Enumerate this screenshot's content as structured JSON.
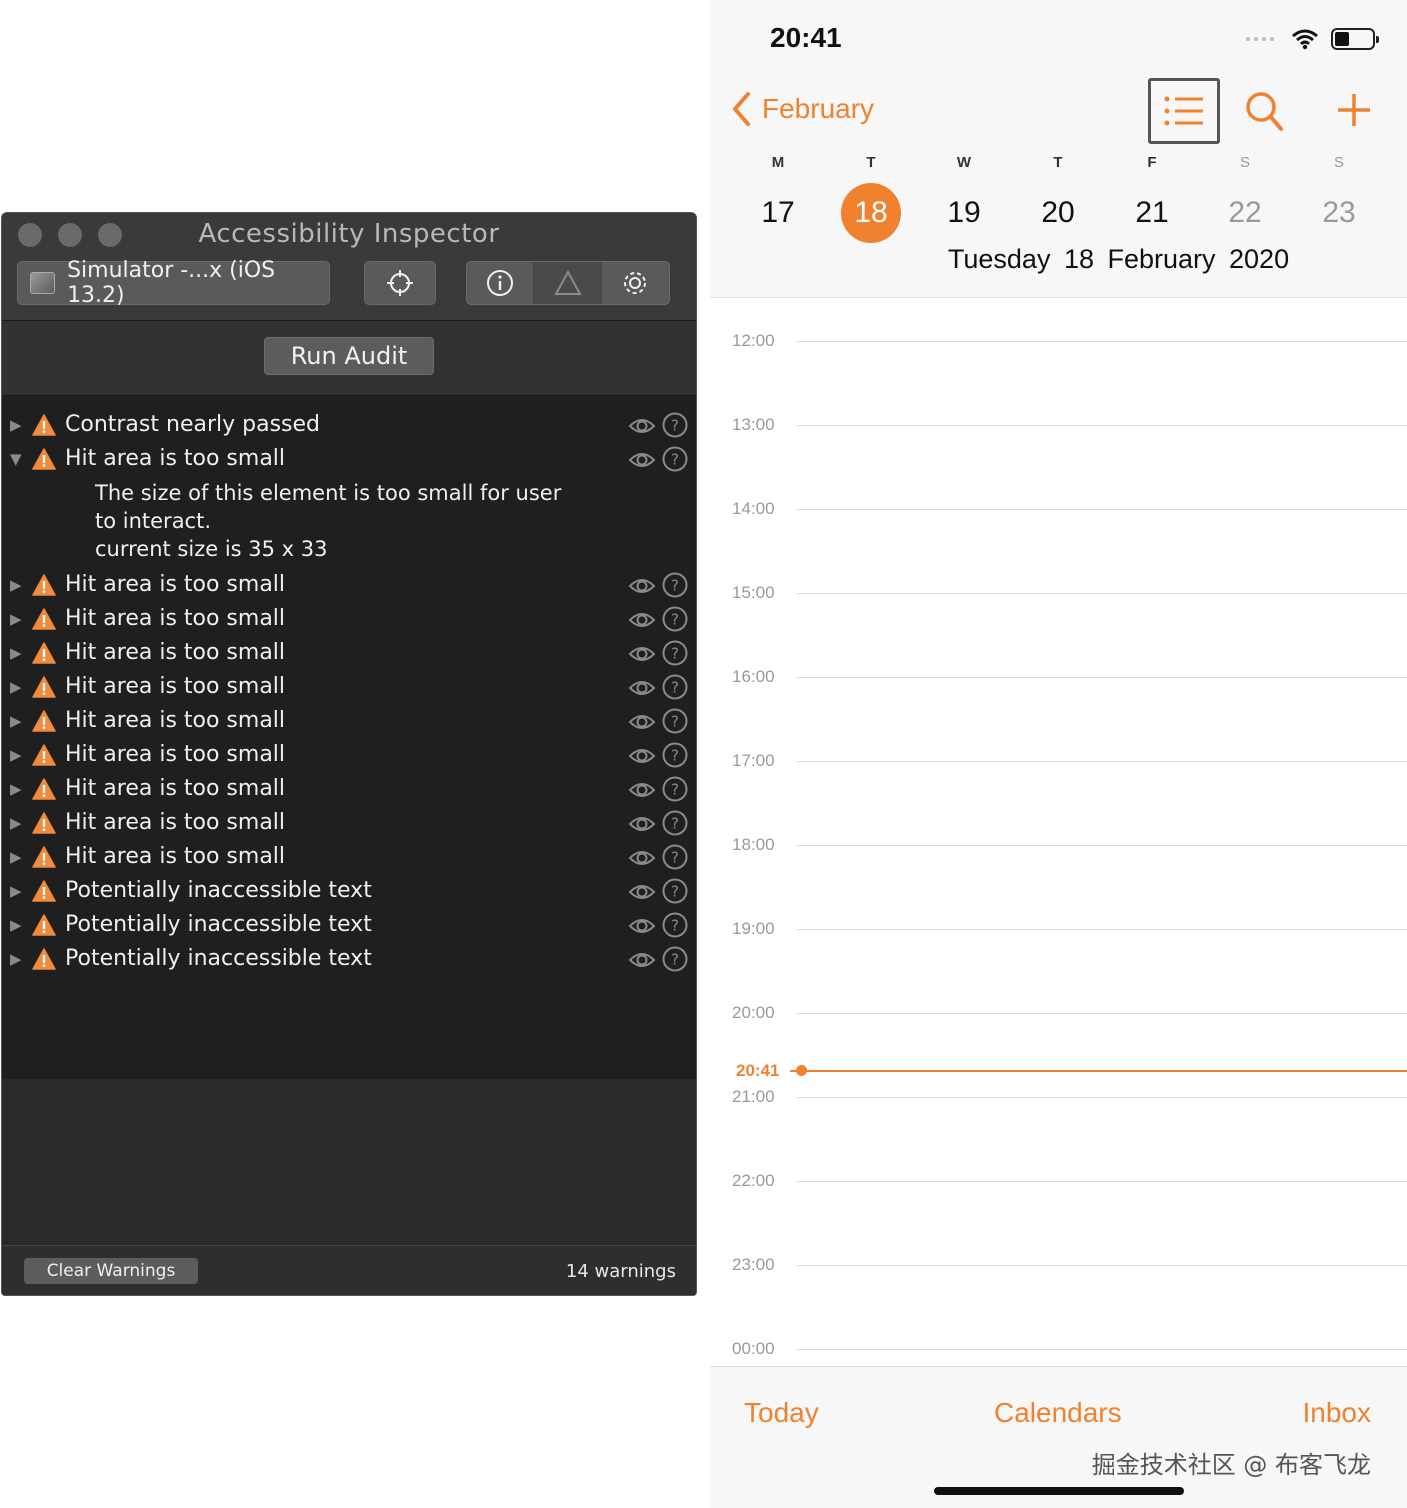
{
  "inspector": {
    "title": "Accessibility Inspector",
    "target": "Simulator -...x (iOS 13.2)",
    "run_audit": "Run Audit",
    "warnings": [
      {
        "label": "Contrast nearly passed",
        "expanded": false
      },
      {
        "label": "Hit area is too small",
        "expanded": true
      },
      {
        "label": "Hit area is too small",
        "expanded": false
      },
      {
        "label": "Hit area is too small",
        "expanded": false
      },
      {
        "label": "Hit area is too small",
        "expanded": false
      },
      {
        "label": "Hit area is too small",
        "expanded": false
      },
      {
        "label": "Hit area is too small",
        "expanded": false
      },
      {
        "label": "Hit area is too small",
        "expanded": false
      },
      {
        "label": "Hit area is too small",
        "expanded": false
      },
      {
        "label": "Hit area is too small",
        "expanded": false
      },
      {
        "label": "Hit area is too small",
        "expanded": false
      },
      {
        "label": "Potentially inaccessible text",
        "expanded": false
      },
      {
        "label": "Potentially inaccessible text",
        "expanded": false
      },
      {
        "label": "Potentially inaccessible text",
        "expanded": false
      }
    ],
    "detail_lines": [
      "The size of this element is too small for user",
      "to interact.",
      "current size is 35 x 33"
    ],
    "clear_warnings": "Clear Warnings",
    "warning_count": "14 warnings",
    "icons": [
      "simulator-icon",
      "crosshair-icon",
      "info-icon",
      "audit-icon",
      "gear-icon",
      "warning-icon",
      "eye-icon",
      "help-icon"
    ],
    "colors": {
      "warning": "#f08a3c",
      "panel": "#222222"
    }
  },
  "calendar": {
    "status_time": "20:41",
    "back_label": "February",
    "weekdays": [
      "M",
      "T",
      "W",
      "T",
      "F",
      "S",
      "S"
    ],
    "days": [
      "17",
      "18",
      "19",
      "20",
      "21",
      "22",
      "23"
    ],
    "selected_day": "18",
    "date_label": "Tuesday  18 February 2020",
    "hours": [
      "12:00",
      "13:00",
      "14:00",
      "15:00",
      "16:00",
      "17:00",
      "18:00",
      "19:00",
      "20:00",
      "21:00",
      "22:00",
      "23:00",
      "00:00"
    ],
    "now_label": "20:41",
    "tabs": {
      "today": "Today",
      "calendars": "Calendars",
      "inbox": "Inbox"
    },
    "watermark": "掘金技术社区 @ 布客飞龙",
    "accent": "#f0812f",
    "icons": [
      "chevron-left-icon",
      "list-icon",
      "search-icon",
      "plus-icon",
      "wifi-icon",
      "battery-icon"
    ]
  }
}
